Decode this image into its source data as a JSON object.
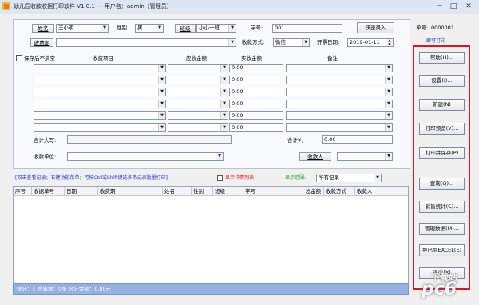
{
  "window": {
    "title": "幼儿园收款收据打印软件 V1.0.1 --- 用户名：admin（管理员）",
    "minimize": "─",
    "maximize": "□",
    "close": "✕"
  },
  "form": {
    "name_label": "姓名",
    "name_value": "王小明",
    "gender_label": "性别",
    "gender_value": "男",
    "class_label": "班级",
    "class_value": "小小一班",
    "student_no_label": "学号:",
    "student_no_value": "001",
    "quick_entry_button": "快速录入",
    "fee_period_label": "收费期",
    "fee_period_value": "",
    "payment_method_label": "收款方式:",
    "payment_method_value": "微信",
    "invoice_date_label": "开票日期:",
    "invoice_date_value": "2019-01-11",
    "receipt_no_label": "单号:",
    "receipt_no_value": "0000001",
    "clear_after_save_label": "保存后不清空",
    "col_item": "收费项目",
    "col_due": "应收金额",
    "col_paid": "实收金额",
    "col_note": "备注",
    "paid_values": [
      "0.00",
      "0.00",
      "0.00",
      "0.00",
      "0.00",
      "0.00"
    ],
    "total_upper_label": "合计大写:",
    "total_upper_value": "",
    "total_amount_label": "合计¥：",
    "total_amount_value": "0.00",
    "payer_unit_label": "收款单位:",
    "payer_unit_value": "",
    "payee_label": "收款人",
    "payee_value": ""
  },
  "right_panel": {
    "print_mode_hint": "即可打印",
    "buttons": [
      "帮助(H)...",
      "设置(I)...",
      "新建(N)",
      "打印预览(V)...",
      "打印并保存(P)",
      "查询(Q)...",
      "销售统计(C)...",
      "管理数据(M)...",
      "导出到EXCEL(E)",
      "退出(X)"
    ]
  },
  "records": {
    "hint": "[双击查看记录；右键功能菜单；可按Ctrl或Shift键选多条记录批量打印]",
    "show_details_label": "显示详情列表",
    "show_range_label": "显示范围:",
    "show_range_value": "所有记录",
    "columns": [
      "序号",
      "收据单号",
      "日期",
      "收费期",
      "姓名",
      "性别",
      "班级",
      "学号",
      "总金额",
      "收款方式",
      "收款人"
    ]
  },
  "status": {
    "summary": "统计：汇总单据：0张 合计金额：0.00元"
  },
  "watermark": {
    "text1": "下载站",
    "text2": "pc6"
  },
  "colors": {
    "accent_red": "#e5121b",
    "hint_blue": "#1f3fcf",
    "green_label": "#1ea31e",
    "status_bar": "#96b0e6"
  }
}
